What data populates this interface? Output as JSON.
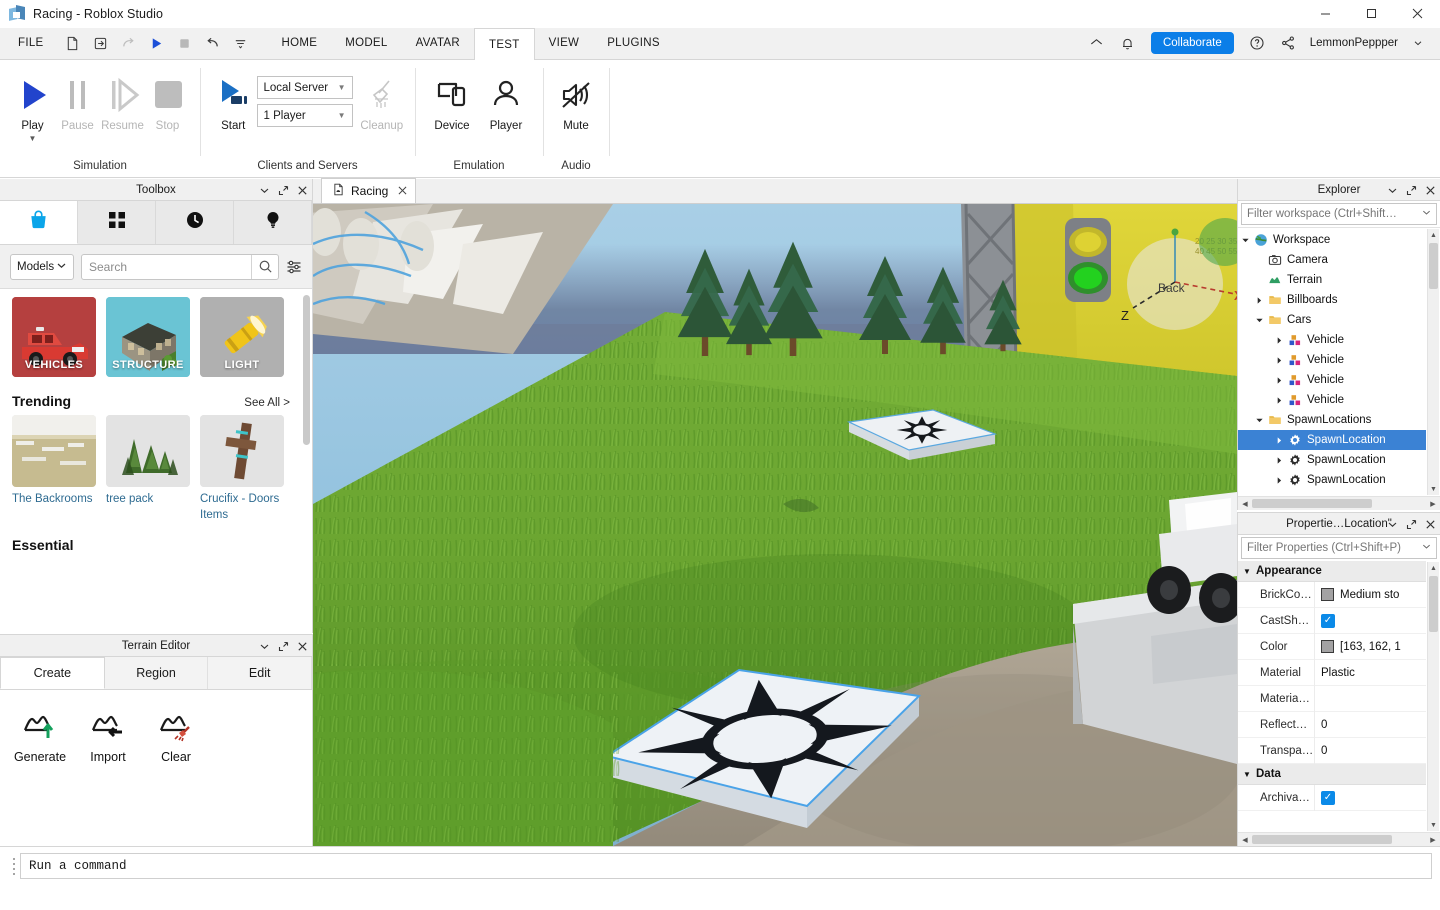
{
  "window": {
    "title": "Racing - Roblox Studio",
    "logo_icon": "roblox-logo-icon",
    "minimize_label": "—",
    "maximize_label": "□",
    "close_label": "✕"
  },
  "menubar": {
    "file_label": "FILE",
    "quick_icons": [
      {
        "name": "new-document-icon",
        "glyph": "document",
        "disabled": false
      },
      {
        "name": "open-file-icon",
        "glyph": "open",
        "disabled": false
      },
      {
        "name": "redo-icon",
        "glyph": "redo",
        "disabled": true
      },
      {
        "name": "play-icon",
        "glyph": "play",
        "disabled": false
      },
      {
        "name": "stop-icon",
        "glyph": "stop",
        "disabled": true
      },
      {
        "name": "undo-icon",
        "glyph": "undo",
        "disabled": false
      },
      {
        "name": "customize-toolbar-icon",
        "glyph": "moreline",
        "disabled": false
      }
    ],
    "tabs": [
      {
        "label": "HOME",
        "active": false
      },
      {
        "label": "MODEL",
        "active": false
      },
      {
        "label": "AVATAR",
        "active": false
      },
      {
        "label": "TEST",
        "active": true
      },
      {
        "label": "VIEW",
        "active": false
      },
      {
        "label": "PLUGINS",
        "active": false
      }
    ],
    "right": {
      "home_icon": "home-icon",
      "notification_icon": "bell-icon",
      "collaborate_label": "Collaborate",
      "collaborate_color": "#0b7ee8",
      "help_icon": "help-circle-icon",
      "share_icon": "share-icon",
      "username": "LemmonPeppper",
      "user_caret_icon": "chevron-down-icon"
    }
  },
  "ribbon": {
    "groups": [
      {
        "label": "Simulation",
        "buttons": [
          {
            "label": "Play",
            "icon": "play-triangle-icon",
            "disabled": false,
            "has_caret": true
          },
          {
            "label": "Pause",
            "icon": "pause-bars-icon",
            "disabled": true,
            "has_caret": false
          },
          {
            "label": "Resume",
            "icon": "resume-triangle-icon",
            "disabled": true,
            "has_caret": false
          },
          {
            "label": "Stop",
            "icon": "stop-square-icon",
            "disabled": true,
            "has_caret": false
          }
        ]
      },
      {
        "label": "Clients and Servers",
        "buttons": [
          {
            "label": "Start",
            "icon": "start-server-icon",
            "disabled": false,
            "has_caret": false
          }
        ],
        "combos": [
          {
            "name": "server-type-select",
            "value": "Local Server"
          },
          {
            "name": "player-count-select",
            "value": "1 Player"
          }
        ],
        "buttons_after": [
          {
            "label": "Cleanup",
            "icon": "broom-icon",
            "disabled": true,
            "has_caret": false
          }
        ]
      },
      {
        "label": "Emulation",
        "buttons": [
          {
            "label": "Device",
            "icon": "device-icon",
            "disabled": false,
            "has_caret": false
          },
          {
            "label": "Player",
            "icon": "person-icon",
            "disabled": false,
            "has_caret": false
          }
        ]
      },
      {
        "label": "Audio",
        "buttons": [
          {
            "label": "Mute",
            "icon": "mute-speaker-icon",
            "disabled": false,
            "has_caret": false
          }
        ]
      }
    ]
  },
  "toolbox": {
    "title": "Toolbox",
    "panel_buttons": [
      {
        "name": "toolbox-collapse-button",
        "glyph": "chevron-down"
      },
      {
        "name": "toolbox-popout-button",
        "glyph": "popout"
      },
      {
        "name": "toolbox-close-button",
        "glyph": "close"
      }
    ],
    "tabs": [
      {
        "name": "tab-marketplace",
        "icon": "shopping-bag-icon",
        "active": true
      },
      {
        "name": "tab-inventory",
        "icon": "grid-squares-icon",
        "active": false
      },
      {
        "name": "tab-recent",
        "icon": "clock-icon",
        "active": false
      },
      {
        "name": "tab-creations",
        "icon": "lightbulb-icon",
        "active": false
      }
    ],
    "category_select": "Models",
    "category_caret_icon": "chevron-down-icon",
    "search_placeholder": "Search",
    "search_value": "",
    "search_icon": "magnifier-icon",
    "filter_icon": "sliders-icon",
    "categories": [
      {
        "name": "VEHICLES",
        "bg": "#b5403f",
        "art": "fire-truck"
      },
      {
        "name": "STRUCTURE",
        "bg": "#6ac4d4",
        "art": "house"
      },
      {
        "name": "LIGHT",
        "bg": "#b0b0b0",
        "art": "flashlight"
      }
    ],
    "trending_title": "Trending",
    "see_all_label": "See All >",
    "trending_items": [
      {
        "name": "The Backrooms",
        "art": "backrooms"
      },
      {
        "name": "tree pack",
        "art": "trees"
      },
      {
        "name": "Crucifix - Doors Items",
        "art": "crucifix"
      }
    ],
    "essential_title": "Essential"
  },
  "terrain_editor": {
    "title": "Terrain Editor",
    "panel_buttons": [
      {
        "name": "terrain-collapse-button",
        "glyph": "chevron-down"
      },
      {
        "name": "terrain-popout-button",
        "glyph": "popout"
      },
      {
        "name": "terrain-close-button",
        "glyph": "close"
      }
    ],
    "tabs": [
      {
        "label": "Create",
        "active": true
      },
      {
        "label": "Region",
        "active": false
      },
      {
        "label": "Edit",
        "active": false
      }
    ],
    "buttons": [
      {
        "label": "Generate",
        "icon": "terrain-generate-icon",
        "accent": "#1f9a5a"
      },
      {
        "label": "Import",
        "icon": "terrain-import-icon",
        "accent": "#111111"
      },
      {
        "label": "Clear",
        "icon": "terrain-clear-icon",
        "accent": "#c23b2b"
      }
    ]
  },
  "viewport": {
    "tab_label": "Racing",
    "tab_icon": "place-file-icon",
    "tab_close_icon": "close-icon",
    "scene": {
      "sky_color": "#8fc0dd",
      "horizon_color": "#5d6a8a",
      "grass_color": "#6aa92f",
      "ground_color": "#a79c8b",
      "billboard_color": "#d6cc2e",
      "gizmo": {
        "x_label": "X",
        "z_label": "Z",
        "back_label": "Back"
      }
    }
  },
  "explorer": {
    "title": "Explorer",
    "panel_buttons": [
      {
        "name": "explorer-collapse-button",
        "glyph": "chevron-down"
      },
      {
        "name": "explorer-popout-button",
        "glyph": "popout"
      },
      {
        "name": "explorer-close-button",
        "glyph": "close"
      }
    ],
    "filter_placeholder": "Filter workspace (Ctrl+Shift…",
    "filter_caret_icon": "chevron-down-icon",
    "tree": [
      {
        "label": "Workspace",
        "depth": 0,
        "arrow": "down",
        "icon": "workspace-globe-icon",
        "selected": false
      },
      {
        "label": "Camera",
        "depth": 1,
        "arrow": "none",
        "icon": "camera-icon",
        "selected": false
      },
      {
        "label": "Terrain",
        "depth": 1,
        "arrow": "none",
        "icon": "terrain-icon",
        "selected": false
      },
      {
        "label": "Billboards",
        "depth": 1,
        "arrow": "right",
        "icon": "folder-icon",
        "selected": false
      },
      {
        "label": "Cars",
        "depth": 1,
        "arrow": "down",
        "icon": "folder-icon",
        "selected": false
      },
      {
        "label": "Vehicle",
        "depth": 2,
        "arrow": "right",
        "icon": "model-icon",
        "selected": false
      },
      {
        "label": "Vehicle",
        "depth": 2,
        "arrow": "right",
        "icon": "model-icon",
        "selected": false
      },
      {
        "label": "Vehicle",
        "depth": 2,
        "arrow": "right",
        "icon": "model-icon",
        "selected": false
      },
      {
        "label": "Vehicle",
        "depth": 2,
        "arrow": "right",
        "icon": "model-icon",
        "selected": false
      },
      {
        "label": "SpawnLocations",
        "depth": 1,
        "arrow": "down",
        "icon": "folder-icon",
        "selected": false
      },
      {
        "label": "SpawnLocation",
        "depth": 2,
        "arrow": "right",
        "icon": "spawn-gear-icon",
        "selected": true
      },
      {
        "label": "SpawnLocation",
        "depth": 2,
        "arrow": "right",
        "icon": "spawn-gear-icon",
        "selected": false
      },
      {
        "label": "SpawnLocation",
        "depth": 2,
        "arrow": "right",
        "icon": "spawn-gear-icon",
        "selected": false
      }
    ],
    "selection_color": "#3b82d4"
  },
  "properties": {
    "title": "Propertie…Location\"",
    "panel_buttons": [
      {
        "name": "properties-collapse-button",
        "glyph": "chevron-down"
      },
      {
        "name": "properties-popout-button",
        "glyph": "popout"
      },
      {
        "name": "properties-close-button",
        "glyph": "close"
      }
    ],
    "filter_placeholder": "Filter Properties (Ctrl+Shift+P)",
    "filter_caret_icon": "chevron-down-icon",
    "groups": [
      {
        "name": "Appearance",
        "expanded": true,
        "rows": [
          {
            "name": "BrickCo…",
            "type": "color",
            "value": "Medium sto",
            "swatch": "#a3a2a3"
          },
          {
            "name": "CastSh…",
            "type": "check",
            "value": "",
            "checked": true
          },
          {
            "name": "Color",
            "type": "color",
            "value": "[163, 162, 1",
            "swatch": "#a3a2a3"
          },
          {
            "name": "Material",
            "type": "text",
            "value": "Plastic"
          },
          {
            "name": "Materia…",
            "type": "text",
            "value": ""
          },
          {
            "name": "Reflect…",
            "type": "text",
            "value": "0"
          },
          {
            "name": "Transpa…",
            "type": "text",
            "value": "0"
          }
        ]
      },
      {
        "name": "Data",
        "expanded": true,
        "rows": [
          {
            "name": "Archiva…",
            "type": "check",
            "value": "",
            "checked": true
          }
        ]
      }
    ]
  },
  "command_bar": {
    "placeholder": "Run a command",
    "value": "",
    "grip_icon": "drag-grip-icon"
  }
}
